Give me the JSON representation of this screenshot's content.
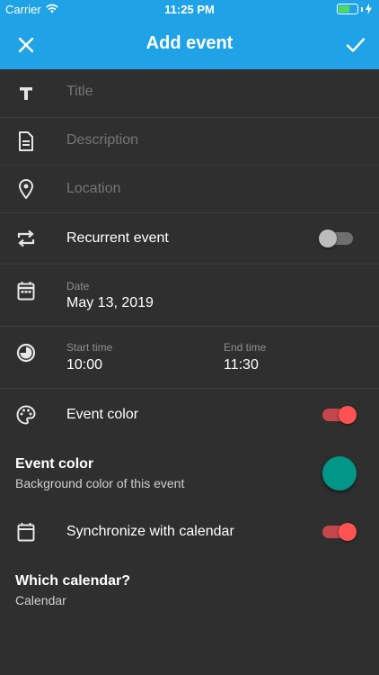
{
  "status_bar": {
    "carrier": "Carrier",
    "time": "11:25 PM"
  },
  "app_bar": {
    "title": "Add event"
  },
  "fields": {
    "title_placeholder": "Title",
    "description_placeholder": "Description",
    "location_placeholder": "Location"
  },
  "recurrent": {
    "label": "Recurrent event",
    "enabled": false
  },
  "date": {
    "label": "Date",
    "value": "May 13, 2019"
  },
  "time": {
    "start_label": "Start time",
    "start_value": "10:00",
    "end_label": "End time",
    "end_value": "11:30"
  },
  "event_color_toggle": {
    "label": "Event color",
    "enabled": true
  },
  "event_color_picker": {
    "title": "Event color",
    "subtitle": "Background color of this event",
    "color": "#009688"
  },
  "sync": {
    "label": "Synchronize with calendar",
    "enabled": true
  },
  "which_calendar": {
    "title": "Which calendar?",
    "value": "Calendar"
  },
  "colors": {
    "accent": "#1fa3e6",
    "background": "#2f2f2f",
    "switch_on": "#ff5252"
  }
}
